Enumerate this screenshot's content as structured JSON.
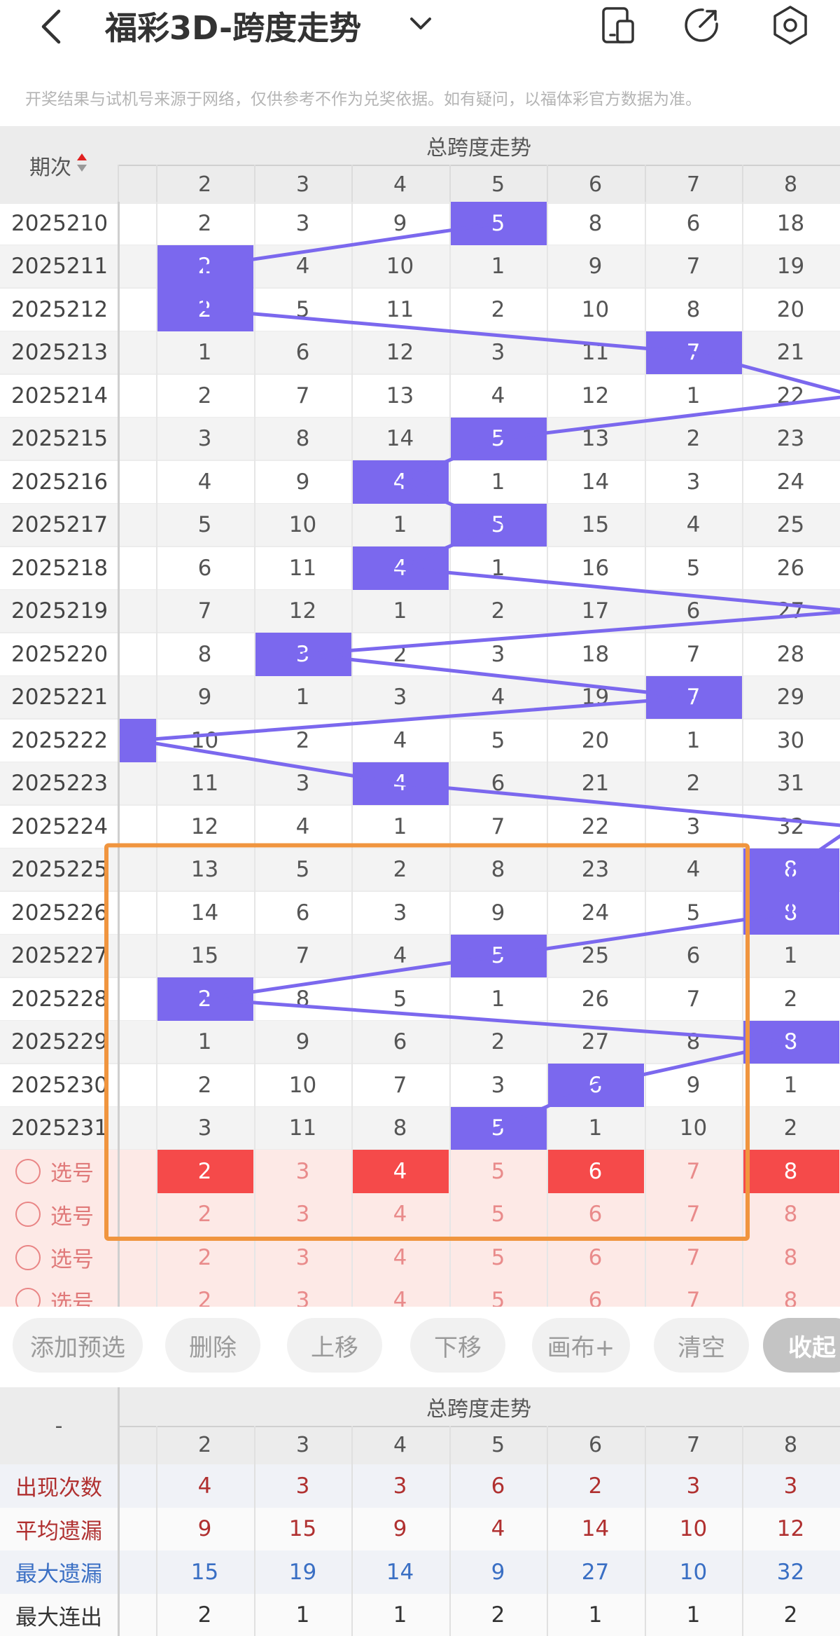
{
  "header": {
    "title": "福彩3D-跨度走势",
    "notice": "开奖结果与试机号来源于网络，仅供参考不作为兑奖依据。如有疑问，以福体彩官方数据为准。",
    "icons": [
      "back-icon",
      "chevron-down-icon",
      "device-icon",
      "share-icon",
      "settings-icon"
    ]
  },
  "table": {
    "period_header": "期次",
    "group_header": "总跨度走势",
    "columns": [
      "2",
      "3",
      "4",
      "5",
      "6",
      "7",
      "8"
    ],
    "rows": [
      {
        "period": "2025210",
        "values": [
          "2",
          "3",
          "9",
          "5",
          "8",
          "6",
          "18"
        ],
        "hit": 3
      },
      {
        "period": "2025211",
        "values": [
          "2",
          "4",
          "10",
          "1",
          "9",
          "7",
          "19"
        ],
        "hit": 0
      },
      {
        "period": "2025212",
        "values": [
          "2",
          "5",
          "11",
          "2",
          "10",
          "8",
          "20"
        ],
        "hit": 0
      },
      {
        "period": "2025213",
        "values": [
          "1",
          "6",
          "12",
          "3",
          "11",
          "7",
          "21"
        ],
        "hit": 5
      },
      {
        "period": "2025214",
        "values": [
          "2",
          "7",
          "13",
          "4",
          "12",
          "1",
          "22"
        ],
        "hit": -1
      },
      {
        "period": "2025215",
        "values": [
          "3",
          "8",
          "14",
          "5",
          "13",
          "2",
          "23"
        ],
        "hit": 3
      },
      {
        "period": "2025216",
        "values": [
          "4",
          "9",
          "4",
          "1",
          "14",
          "3",
          "24"
        ],
        "hit": 2
      },
      {
        "period": "2025217",
        "values": [
          "5",
          "10",
          "1",
          "5",
          "15",
          "4",
          "25"
        ],
        "hit": 3
      },
      {
        "period": "2025218",
        "values": [
          "6",
          "11",
          "4",
          "1",
          "16",
          "5",
          "26"
        ],
        "hit": 2
      },
      {
        "period": "2025219",
        "values": [
          "7",
          "12",
          "1",
          "2",
          "17",
          "6",
          "27"
        ],
        "hit": -1
      },
      {
        "period": "2025220",
        "values": [
          "8",
          "3",
          "2",
          "3",
          "18",
          "7",
          "28"
        ],
        "hit": 1
      },
      {
        "period": "2025221",
        "values": [
          "9",
          "1",
          "3",
          "4",
          "19",
          "7",
          "29"
        ],
        "hit": 5
      },
      {
        "period": "2025222",
        "values": [
          "10",
          "2",
          "4",
          "5",
          "20",
          "1",
          "30"
        ],
        "hit": -2
      },
      {
        "period": "2025223",
        "values": [
          "11",
          "3",
          "4",
          "6",
          "21",
          "2",
          "31"
        ],
        "hit": 2
      },
      {
        "period": "2025224",
        "values": [
          "12",
          "4",
          "1",
          "7",
          "22",
          "3",
          "32"
        ],
        "hit": -1
      },
      {
        "period": "2025225",
        "values": [
          "13",
          "5",
          "2",
          "8",
          "23",
          "4",
          "8"
        ],
        "hit": 6
      },
      {
        "period": "2025226",
        "values": [
          "14",
          "6",
          "3",
          "9",
          "24",
          "5",
          "8"
        ],
        "hit": 6
      },
      {
        "period": "2025227",
        "values": [
          "15",
          "7",
          "4",
          "5",
          "25",
          "6",
          "1"
        ],
        "hit": 3
      },
      {
        "period": "2025228",
        "values": [
          "2",
          "8",
          "5",
          "1",
          "26",
          "7",
          "2"
        ],
        "hit": 0
      },
      {
        "period": "2025229",
        "values": [
          "1",
          "9",
          "6",
          "2",
          "27",
          "8",
          "8"
        ],
        "hit": 6
      },
      {
        "period": "2025230",
        "values": [
          "2",
          "10",
          "7",
          "3",
          "6",
          "9",
          "1"
        ],
        "hit": 4
      },
      {
        "period": "2025231",
        "values": [
          "3",
          "11",
          "8",
          "5",
          "1",
          "10",
          "2"
        ],
        "hit": 3
      }
    ],
    "select_rows": [
      {
        "label": "选号",
        "values": [
          "2",
          "3",
          "4",
          "5",
          "6",
          "7",
          "8"
        ],
        "selected": [
          0,
          2,
          4,
          6
        ]
      },
      {
        "label": "选号",
        "values": [
          "2",
          "3",
          "4",
          "5",
          "6",
          "7",
          "8"
        ],
        "selected": []
      },
      {
        "label": "选号",
        "values": [
          "2",
          "3",
          "4",
          "5",
          "6",
          "7",
          "8"
        ],
        "selected": []
      },
      {
        "label": "选号",
        "values": [
          "2",
          "3",
          "4",
          "5",
          "6",
          "7",
          "8"
        ],
        "selected": []
      }
    ]
  },
  "toolbar": {
    "add": "添加预选",
    "delete": "删除",
    "up": "上移",
    "down": "下移",
    "canvas": "画布+",
    "clear": "清空",
    "collapse": "收起"
  },
  "stats": {
    "corner": "-",
    "group_header": "总跨度走势",
    "columns": [
      "2",
      "3",
      "4",
      "5",
      "6",
      "7",
      "8"
    ],
    "rows": [
      {
        "label": "出现次数",
        "values": [
          "4",
          "3",
          "3",
          "6",
          "2",
          "3",
          "3"
        ],
        "color": "#b03030"
      },
      {
        "label": "平均遗漏",
        "values": [
          "9",
          "15",
          "9",
          "4",
          "14",
          "10",
          "12"
        ],
        "color": "#b03030"
      },
      {
        "label": "最大遗漏",
        "values": [
          "15",
          "19",
          "14",
          "9",
          "27",
          "10",
          "32"
        ],
        "color": "#3a6fc4"
      },
      {
        "label": "最大连出",
        "values": [
          "2",
          "1",
          "1",
          "2",
          "1",
          "1",
          "2"
        ],
        "color": "#333333"
      }
    ]
  },
  "colors": {
    "hit": "#7b68ee",
    "line": "#7b68ee",
    "pick": "#f54a4a",
    "highlight_box": "#f0953f",
    "selection_bg": "#fde9e6"
  }
}
